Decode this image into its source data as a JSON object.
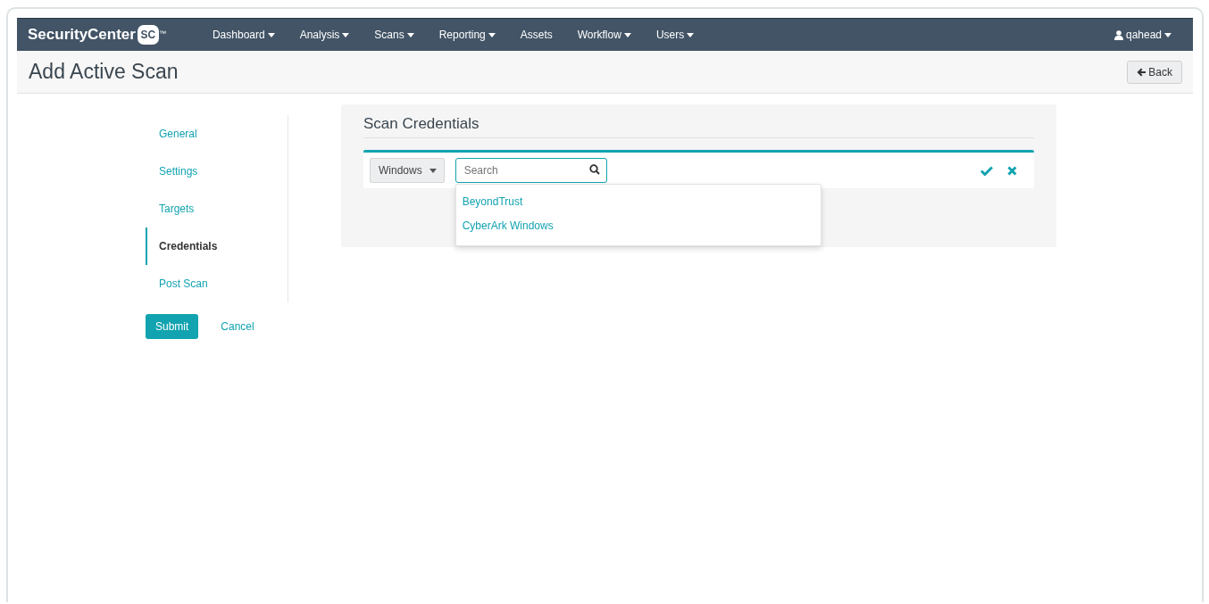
{
  "brand": {
    "name": "SecurityCenter",
    "badge": "SC",
    "mark": "™"
  },
  "nav": [
    {
      "label": "Dashboard",
      "menu": true
    },
    {
      "label": "Analysis",
      "menu": true
    },
    {
      "label": "Scans",
      "menu": true
    },
    {
      "label": "Reporting",
      "menu": true
    },
    {
      "label": "Assets",
      "menu": false
    },
    {
      "label": "Workflow",
      "menu": true
    },
    {
      "label": "Users",
      "menu": true
    }
  ],
  "user": {
    "name": "qahead"
  },
  "page": {
    "title": "Add Active Scan",
    "back": "Back"
  },
  "steps": [
    {
      "label": "General",
      "selected": false
    },
    {
      "label": "Settings",
      "selected": false
    },
    {
      "label": "Targets",
      "selected": false
    },
    {
      "label": "Credentials",
      "selected": true
    },
    {
      "label": "Post Scan",
      "selected": false
    }
  ],
  "actions": {
    "submit": "Submit",
    "cancel": "Cancel"
  },
  "panel": {
    "title": "Scan Credentials",
    "type": "Windows",
    "search": {
      "placeholder": "Search"
    },
    "suggestions": [
      "BeyondTrust",
      "CyberArk Windows"
    ]
  }
}
